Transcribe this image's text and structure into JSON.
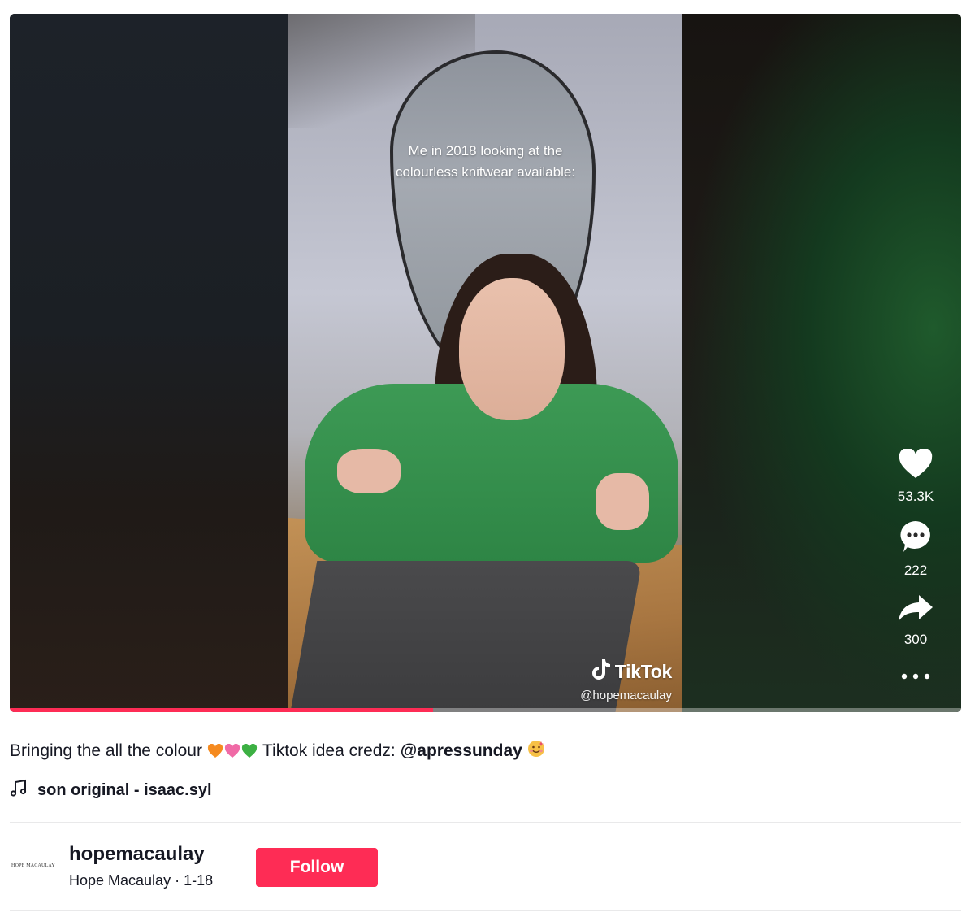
{
  "video": {
    "overlay_caption": "Me in 2018 looking at the colourless knitwear available:",
    "watermark_brand": "TikTok",
    "watermark_handle": "@hopemacaulay",
    "progress_fraction": 0.445
  },
  "actions": {
    "likes": "53.3K",
    "comments": "222",
    "shares": "300"
  },
  "description": {
    "text_before": "Bringing the all the colour",
    "text_middle": "Tiktok idea credz:",
    "mention": "@apressunday"
  },
  "music": {
    "title": "son original - isaac.syl"
  },
  "author": {
    "avatar_text": "HOPE MACAULAY",
    "handle": "hopemacaulay",
    "name_and_date": "Hope Macaulay · 1-18",
    "follow_label": "Follow"
  },
  "colors": {
    "accent": "#fe2c55",
    "text": "#161823"
  },
  "icons": [
    "heart-icon",
    "comment-icon",
    "share-icon",
    "more-icon",
    "music-note-icon",
    "tiktok-logo-icon"
  ]
}
